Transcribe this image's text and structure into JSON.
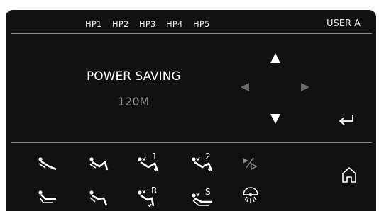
{
  "header": {
    "handpieces": [
      "HP1",
      "HP2",
      "HP3",
      "HP4",
      "HP5"
    ],
    "user_label": "USER A"
  },
  "display": {
    "mode_label": "POWER SAVING",
    "time_value": "120M"
  },
  "nav": {
    "up_icon": "triangle-up-icon",
    "down_icon": "triangle-down-icon",
    "left_icon": "triangle-left-icon",
    "right_icon": "triangle-right-icon",
    "enter_icon": "enter-return-icon"
  },
  "chair_positions": {
    "row1": [
      {
        "icon": "chair-position-1-icon"
      },
      {
        "icon": "chair-position-2-icon"
      },
      {
        "icon": "chair-memory-1-icon",
        "label": "1"
      },
      {
        "icon": "chair-memory-2-icon",
        "label": "2"
      },
      {
        "icon": "play-step-icon"
      }
    ],
    "row2": [
      {
        "icon": "chair-position-3-icon"
      },
      {
        "icon": "chair-position-4-icon"
      },
      {
        "icon": "chair-rinse-position-icon",
        "label": "R"
      },
      {
        "icon": "chair-start-position-icon",
        "label": "S"
      },
      {
        "icon": "operating-light-icon"
      }
    ]
  },
  "home_icon": "home-icon",
  "colors": {
    "panel": "#111111",
    "text": "#e8e8e8",
    "dim_text": "#8c8c8c",
    "dim_arrow": "#6a6a6a",
    "separator": "#8a8a8a"
  }
}
